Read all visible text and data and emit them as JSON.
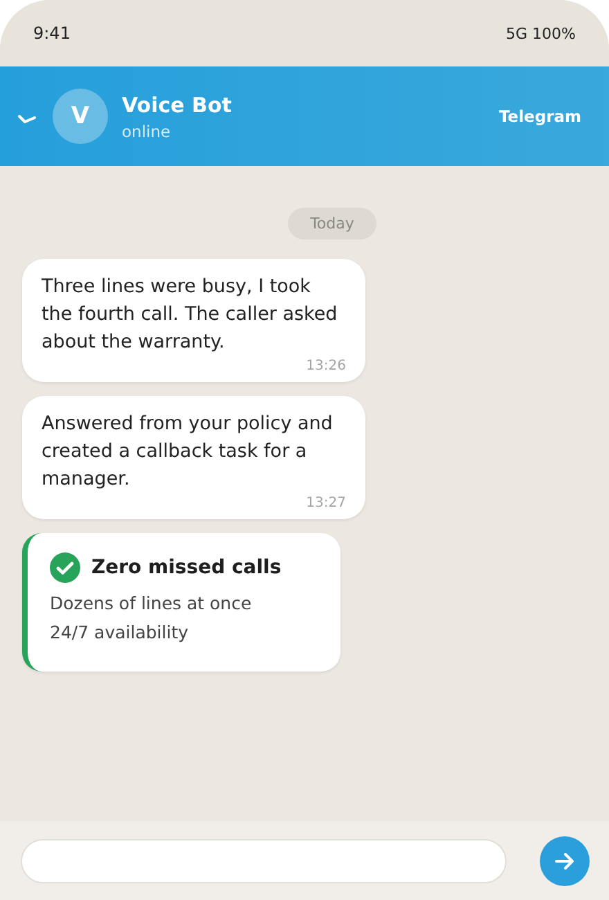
{
  "status_bar": {
    "time": "9:41",
    "network": "5G 100%"
  },
  "header": {
    "avatar": "V",
    "title": "Voice Bot",
    "subtitle": "online",
    "app": "Telegram"
  },
  "date_chip": "Today",
  "messages": [
    {
      "kind": "text",
      "text": "Three lines were busy, I took the fourth call. The caller asked about the warranty.",
      "time": "13:26"
    },
    {
      "kind": "text",
      "text": "Answered from your policy and created a callback task for a manager.",
      "time": "13:27"
    },
    {
      "kind": "card",
      "title": "Zero missed calls",
      "lines": [
        "Dozens of lines at once",
        "24/7 availability"
      ]
    }
  ]
}
